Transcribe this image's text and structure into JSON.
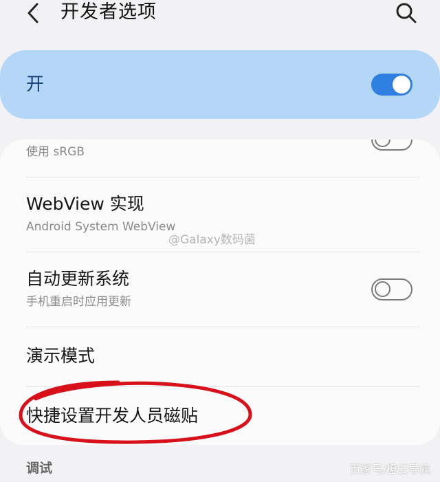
{
  "header": {
    "title": "开发者选项",
    "back_icon": "chevron-left-icon",
    "search_icon": "search-icon"
  },
  "master_toggle": {
    "label": "开",
    "state": "on"
  },
  "settings": {
    "srgb": {
      "subtitle": "使用 sRGB",
      "state": "off"
    },
    "webview": {
      "title": "WebView 实现",
      "subtitle": "Android System WebView"
    },
    "auto_update": {
      "title": "自动更新系统",
      "subtitle": "手机重启时应用更新",
      "state": "off"
    },
    "demo_mode": {
      "title": "演示模式"
    },
    "quick_tiles": {
      "title": "快捷设置开发人员磁贴"
    }
  },
  "section": {
    "debug_header": "调试"
  },
  "watermarks": {
    "center": "@Galaxy数码菌",
    "bottom_right": "百家号/橙云导航"
  },
  "colors": {
    "accent": "#2f7fe0",
    "master_card": "#b4d6f7",
    "annotation": "#d8101a"
  }
}
